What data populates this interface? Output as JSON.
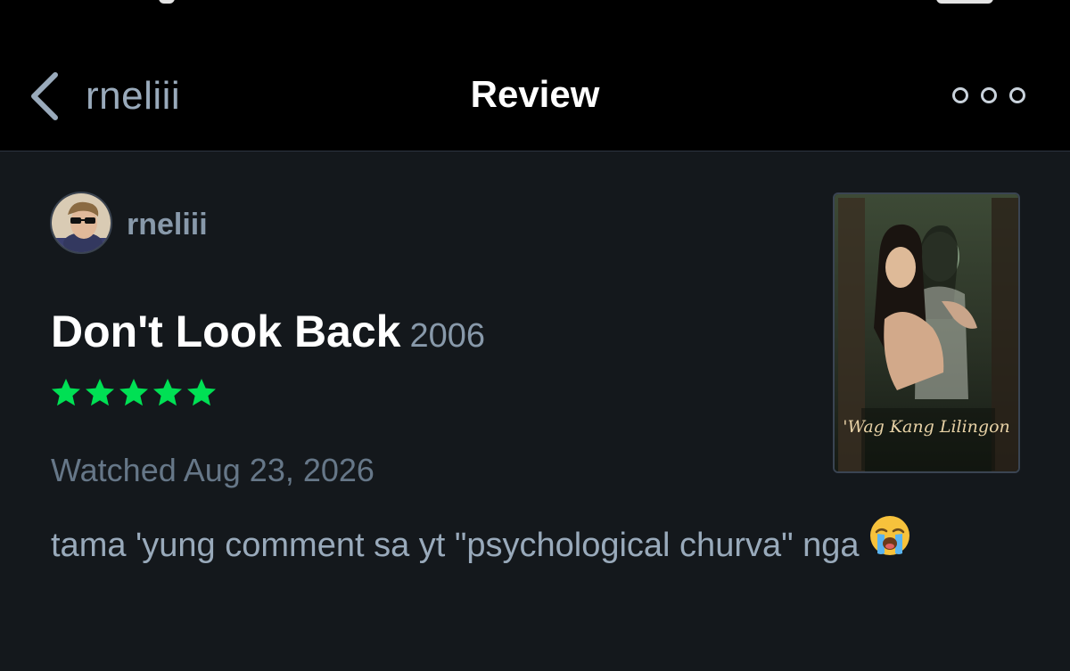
{
  "nav": {
    "back_label": "rneliii",
    "title": "Review",
    "more_icon": "ellipsis-icon"
  },
  "review": {
    "username": "rneliii",
    "film_title": "Don't Look Back",
    "film_year": "2006",
    "rating_stars": 5,
    "star_color": "#00e054",
    "watched": "Watched Aug 23, 2026",
    "body": "tama 'yung comment sa yt \"psychological churva\" nga",
    "emoji": "loudly-crying-face-icon"
  },
  "poster": {
    "caption": "'Wag Kang Lilingon"
  },
  "colors": {
    "background": "#14181c",
    "navbar": "#000000",
    "accent_green": "#00e054",
    "muted_text": "#99aabb"
  }
}
